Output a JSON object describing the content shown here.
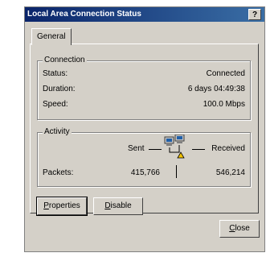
{
  "window": {
    "title": "Local Area Connection Status",
    "help": "?"
  },
  "tabs": [
    {
      "label": "General"
    }
  ],
  "connection": {
    "legend": "Connection",
    "rows": [
      {
        "label": "Status:",
        "value": "Connected"
      },
      {
        "label": "Duration:",
        "value": "6 days 04:49:38"
      },
      {
        "label": "Speed:",
        "value": "100.0 Mbps"
      }
    ]
  },
  "activity": {
    "legend": "Activity",
    "sent_label": "Sent",
    "received_label": "Received",
    "packets_label": "Packets:",
    "packets_sent": "415,766",
    "packets_received": "546,214",
    "icon": "network-computers-icon"
  },
  "buttons": {
    "properties": {
      "key": "P",
      "rest": "roperties"
    },
    "disable": {
      "key": "D",
      "rest": "isable"
    },
    "close": {
      "key": "C",
      "rest": "lose"
    }
  }
}
